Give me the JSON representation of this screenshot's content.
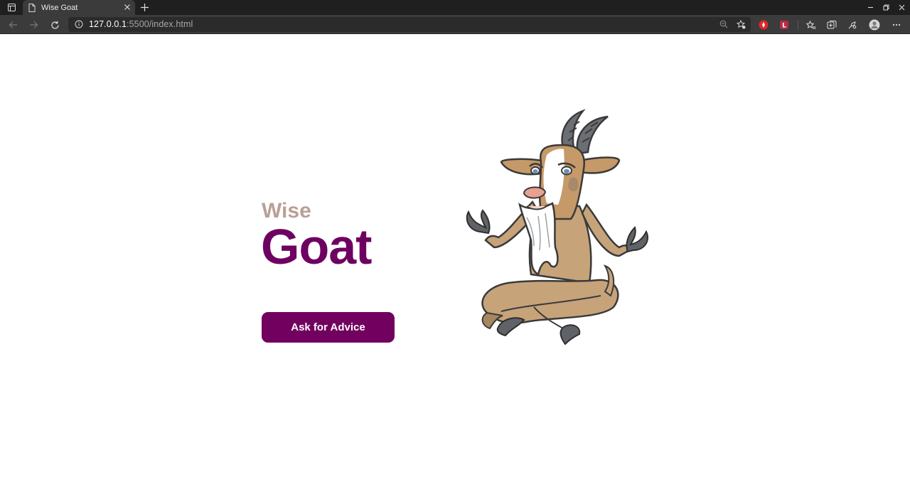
{
  "browser": {
    "tab_title": "Wise Goat",
    "url_host": "127.0.0.1",
    "url_path": ":5500/index.html"
  },
  "page": {
    "eyebrow": "Wise",
    "title": "Goat",
    "cta_label": "Ask for Advice"
  },
  "colors": {
    "accent": "#72005f",
    "eyebrow": "#b8a097",
    "chrome_dark": "#1f1f1f",
    "chrome_tab": "#3b3b3b"
  },
  "icons": [
    "tab-actions-icon",
    "page-icon",
    "close-icon",
    "plus-icon",
    "minimize-icon",
    "restore-icon",
    "close-window-icon",
    "back-icon",
    "forward-icon",
    "reload-icon",
    "info-icon",
    "zoom-icon",
    "favorite-add-icon",
    "extension-icon",
    "favorites-icon",
    "collections-icon",
    "extensions-icon",
    "profile-icon",
    "more-icon"
  ]
}
